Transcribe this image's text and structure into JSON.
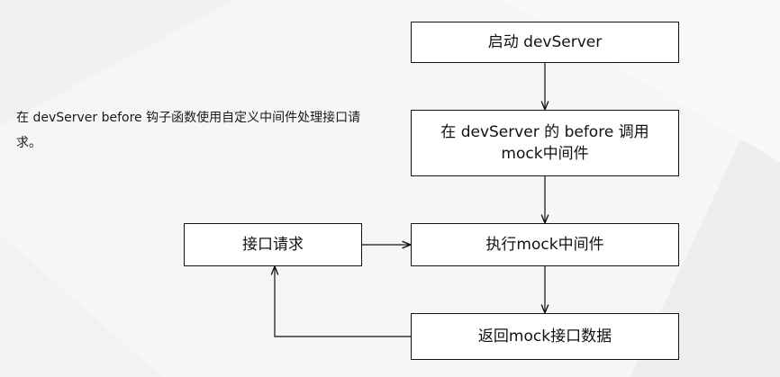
{
  "description": "在 devServer before 钩子函数使用自定义中间件处理接口请求。",
  "nodes": {
    "start": "启动 devServer",
    "before": "在 devServer 的 before 调用mock中间件",
    "exec": "执行mock中间件",
    "return": "返回mock接口数据",
    "request": "接口请求"
  }
}
